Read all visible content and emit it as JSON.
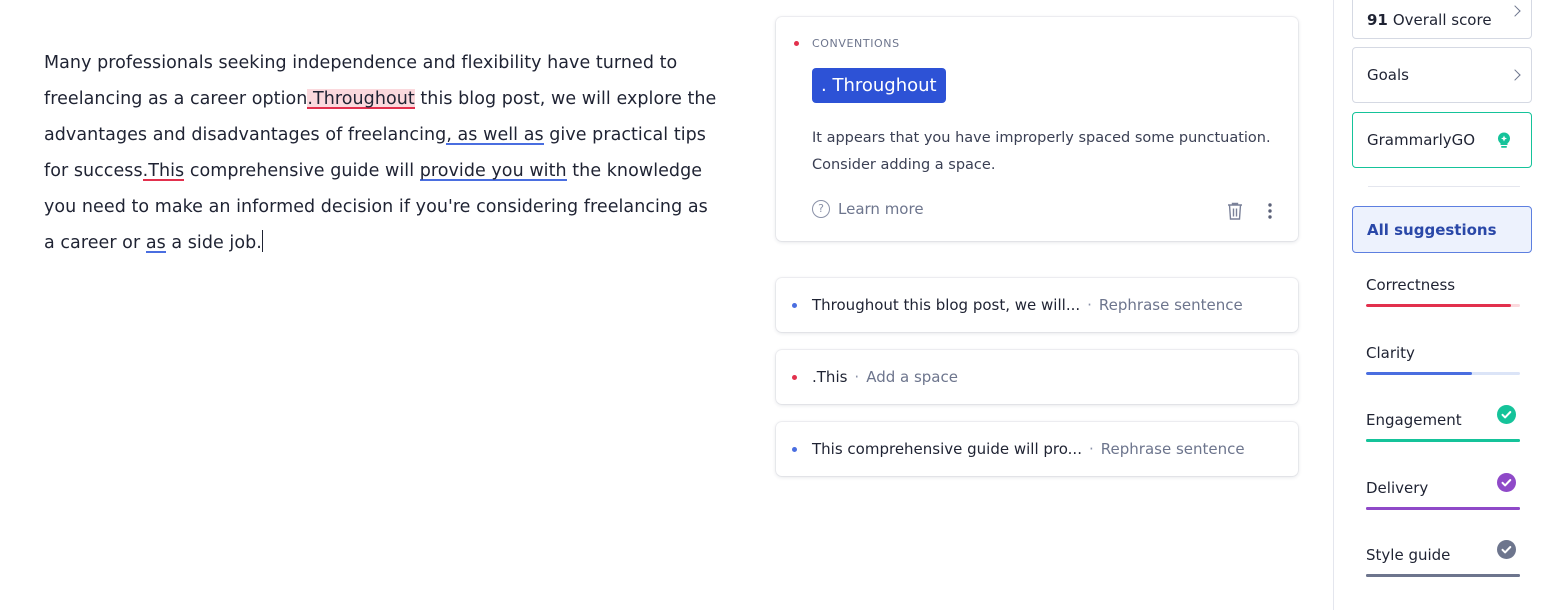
{
  "editor": {
    "segments": [
      {
        "text": "Many professionals seeking independence and flexibility have turned to freelancing as a career option",
        "mark": "none"
      },
      {
        "text": ".Throughout",
        "mark": "red-highlight"
      },
      {
        "text": " this blog post, we will explore the advantages and disadvantages of freelancing",
        "mark": "none"
      },
      {
        "text": ", as well as",
        "mark": "blue-underline"
      },
      {
        "text": " give practical tips for success",
        "mark": "none"
      },
      {
        "text": ".This",
        "mark": "red-underline"
      },
      {
        "text": " comprehensive guide will ",
        "mark": "none"
      },
      {
        "text": "provide you with",
        "mark": "blue-underline"
      },
      {
        "text": " the knowledge you need to make an informed decision if you're considering freelancing as a career or ",
        "mark": "none"
      },
      {
        "text": "as",
        "mark": "blue-underline"
      },
      {
        "text": " a side job.",
        "mark": "none"
      }
    ]
  },
  "active_card": {
    "category": "CONVENTIONS",
    "category_color": "#e2304d",
    "replacement": ". Throughout",
    "explanation": "It appears that you have improperly spaced some punctuation. Consider adding a space.",
    "learn_more": "Learn more",
    "icons": {
      "help": "question-circle-icon",
      "delete": "trash-icon",
      "more": "more-vertical-icon"
    }
  },
  "suggestions": [
    {
      "text": "Throughout this blog post, we will...",
      "action": "Rephrase sentence",
      "color": "#4a6ee0"
    },
    {
      "text": ".This",
      "action": "Add a space",
      "color": "#e2304d"
    },
    {
      "text": "This comprehensive guide will pro...",
      "action": "Rephrase sentence",
      "color": "#4a6ee0"
    }
  ],
  "separator": "·",
  "sidebar": {
    "overall_score": "91",
    "overall_score_label": "Overall score",
    "goals_label": "Goals",
    "grammarlygo_label": "GrammarlyGO",
    "all_suggestions_label": "All suggestions",
    "categories": [
      {
        "name": "Correctness",
        "progress": 0.94,
        "color": "#e2304d",
        "track": "#fbd9dd",
        "complete": false
      },
      {
        "name": "Clarity",
        "progress": 0.69,
        "color": "#4a6ee0",
        "track": "#dbe4f7",
        "complete": false
      },
      {
        "name": "Engagement",
        "progress": 1.0,
        "color": "#15c39a",
        "track": "#15c39a",
        "complete": true
      },
      {
        "name": "Delivery",
        "progress": 1.0,
        "color": "#8f49c8",
        "track": "#8f49c8",
        "complete": true
      },
      {
        "name": "Style guide",
        "progress": 1.0,
        "color": "#6d758d",
        "track": "#6d758d",
        "complete": true
      }
    ]
  }
}
